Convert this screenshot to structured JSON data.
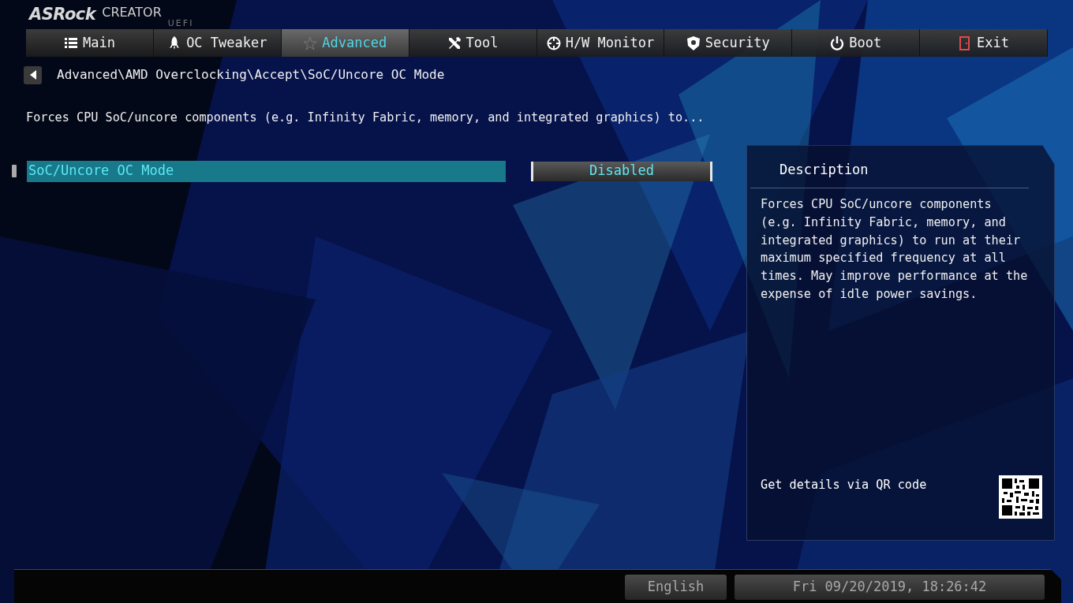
{
  "logo": {
    "brand": "ASRock",
    "product": "CREATOR",
    "subtitle": "UEFI"
  },
  "tabs": [
    {
      "label": "Main",
      "selected": false
    },
    {
      "label": "OC Tweaker",
      "selected": false
    },
    {
      "label": "Advanced",
      "selected": true
    },
    {
      "label": "Tool",
      "selected": false
    },
    {
      "label": "H/W Monitor",
      "selected": false
    },
    {
      "label": "Security",
      "selected": false
    },
    {
      "label": "Boot",
      "selected": false
    },
    {
      "label": "Exit",
      "selected": false
    }
  ],
  "breadcrumb": {
    "path": "Advanced\\AMD Overclocking\\Accept\\SoC/Uncore OC Mode"
  },
  "help_line": "Forces CPU SoC/uncore components (e.g. Infinity Fabric, memory, and integrated graphics) to...",
  "settings": [
    {
      "label": "SoC/Uncore OC Mode",
      "value": "Disabled",
      "selected": true
    }
  ],
  "description": {
    "title": "Description",
    "text": "Forces CPU SoC/uncore components (e.g. Infinity Fabric, memory, and integrated graphics) to run at their maximum specified frequency at all times. May improve performance at the expense of idle power savings.",
    "qr_hint": "Get details via QR code"
  },
  "status_bar": {
    "language": "English",
    "datetime": "Fri 09/20/2019, 18:26:42"
  }
}
